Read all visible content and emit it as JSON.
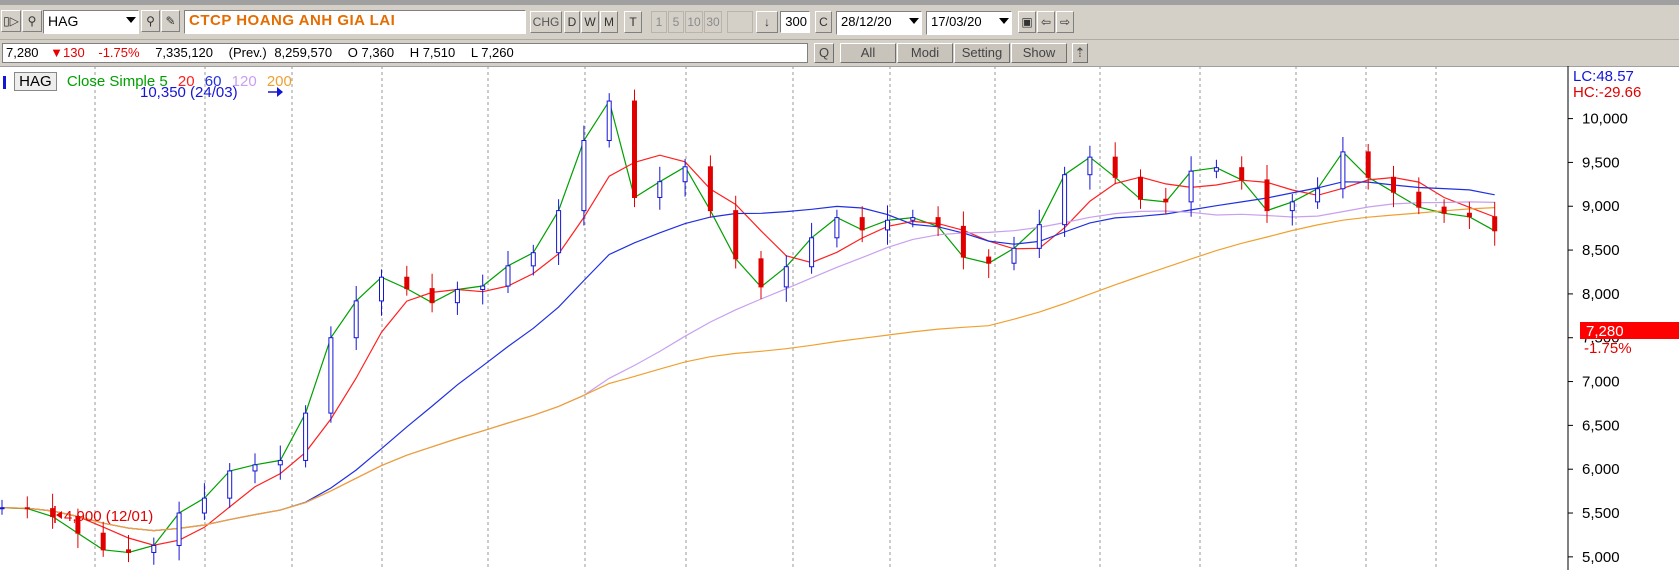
{
  "toolbar": {
    "symbol": "HAG",
    "company_name": "CTCP HOANG ANH GIA LAI",
    "chg_label": "CHG",
    "periods": [
      "D",
      "W",
      "M",
      "T"
    ],
    "intervals": [
      "1",
      "5",
      "10",
      "30"
    ],
    "count": "300",
    "c_label": "C",
    "from_date": "28/12/20",
    "to_date": "17/03/20"
  },
  "quote": {
    "last": "7,280",
    "change": "▼130",
    "pct": "-1.75%",
    "volume": "7,335,120",
    "prev_label": "(Prev.)",
    "prev_volume": "8,259,570",
    "open": "O 7,360",
    "high": "H 7,510",
    "low": "L 7,260"
  },
  "toolbar2": {
    "q_label": "Q",
    "all_label": "All",
    "modi_label": "Modi",
    "setting_label": "Setting",
    "show_label": "Show"
  },
  "legend": {
    "symbol": "HAG",
    "indicator": "Close Simple 5",
    "periods": [
      "20",
      "60",
      "120",
      "200"
    ]
  },
  "annotations": {
    "high_label": "10,350 (24/03)",
    "low_label": "4,900 (12/01)",
    "lc_label": "LC:48.57",
    "hc_label": "HC:-29.66",
    "last_tag": "7,280",
    "last_pct": "-1.75%"
  },
  "colors": {
    "up": "#1515d6",
    "down": "#e00000",
    "ma5": "#00a000",
    "ma20": "#ff2020",
    "ma60": "#2030e0",
    "ma120": "#c8a0f0",
    "ma200": "#f0a030",
    "company": "#e46c00"
  },
  "chart_data": {
    "type": "line",
    "x": [
      0,
      5,
      10,
      15,
      20,
      25,
      30,
      35,
      40,
      45,
      50,
      55,
      60,
      65,
      70,
      75,
      80,
      85,
      90,
      95,
      100,
      105,
      110,
      115,
      120,
      125,
      130,
      135,
      140,
      145,
      150,
      155,
      160,
      165,
      170,
      175,
      180,
      185,
      190,
      195,
      200,
      205,
      210,
      215,
      220,
      225,
      230,
      235,
      240,
      245,
      250,
      255,
      260,
      265,
      270,
      275,
      280,
      285,
      290,
      295
    ],
    "series": [
      {
        "name": "Close",
        "values": [
          5560,
          5550,
          5460,
          5270,
          5080,
          5050,
          5130,
          5500,
          5670,
          5980,
          6050,
          6100,
          6640,
          7500,
          7920,
          8190,
          8060,
          7900,
          8050,
          8090,
          8320,
          8470,
          8950,
          9750,
          10200,
          9100,
          9280,
          9450,
          8950,
          8400,
          8080,
          8310,
          8640,
          8870,
          8730,
          8840,
          8870,
          8770,
          8420,
          8350,
          8520,
          8790,
          9360,
          9560,
          9330,
          9080,
          9050,
          9400,
          9440,
          9300,
          8950,
          9050,
          9200,
          9620,
          9330,
          9160,
          8990,
          8920,
          8880,
          8720
        ]
      },
      {
        "name": "5",
        "values": []
      },
      {
        "name": "20",
        "values": []
      },
      {
        "name": "60",
        "values": []
      },
      {
        "name": "120",
        "values": []
      },
      {
        "name": "200",
        "values": []
      }
    ],
    "yticks": [
      10000,
      9500,
      9000,
      8500,
      8000,
      7500,
      7000,
      6500,
      6000,
      5500,
      5000
    ],
    "ytick_labels": [
      "10,000",
      "9,500",
      "9,000",
      "8,500",
      "8,000",
      "7,500",
      "7,000",
      "6,500",
      "6,000",
      "5,500",
      "5,000"
    ],
    "ylim": [
      4850,
      10600
    ],
    "grid": true
  }
}
